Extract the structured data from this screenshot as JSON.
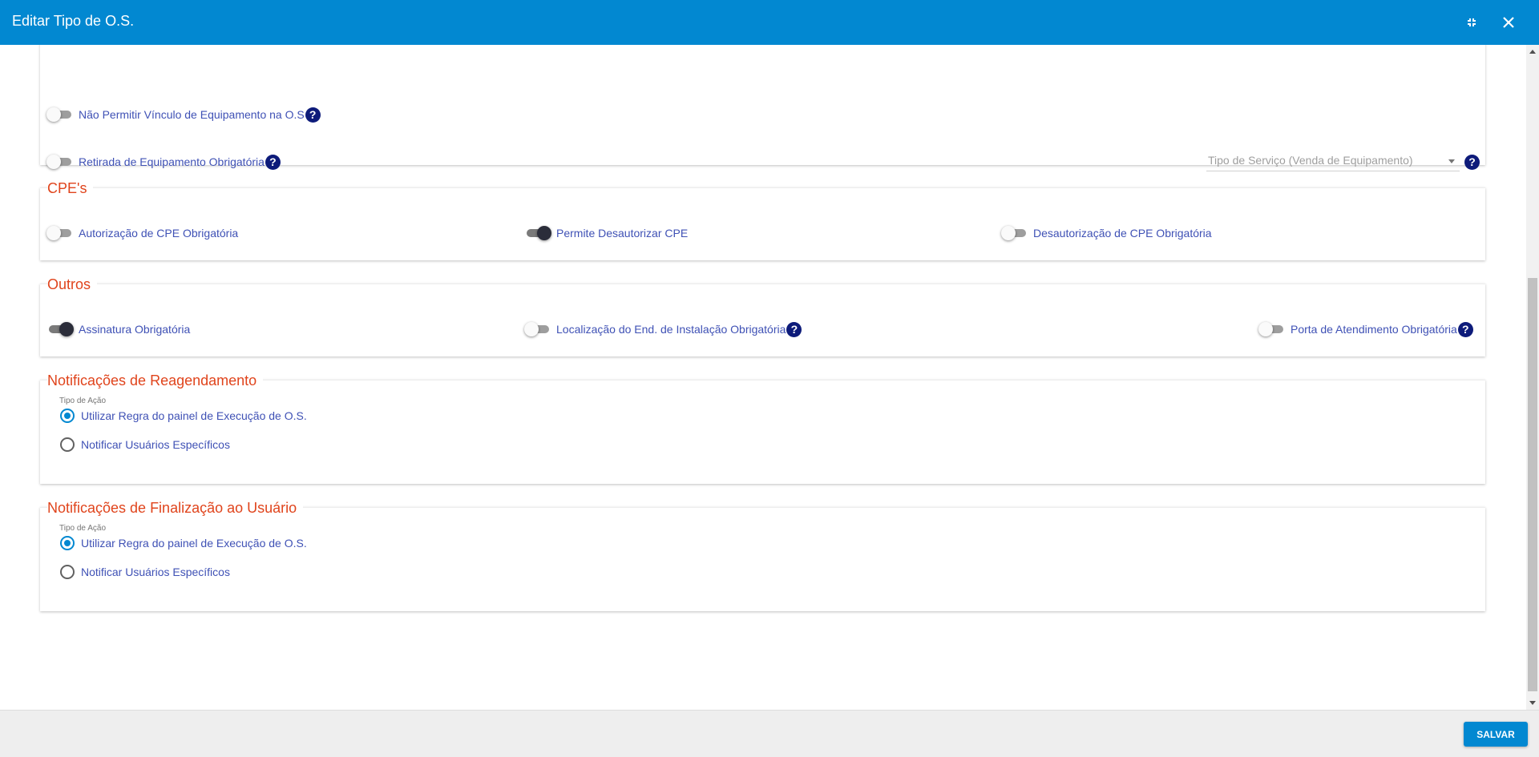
{
  "window": {
    "title": "Editar Tipo de O.S.",
    "minimize_icon": "collapse-icon",
    "close_icon": "close-icon"
  },
  "equipment": {
    "no_link_label": "Não Permitir Vínculo de Equipamento na O.S",
    "no_link_on": false,
    "removal_label": "Retirada de Equipamento Obrigatória",
    "removal_on": false,
    "service_type_placeholder": "Tipo de Serviço (Venda de Equipamento)"
  },
  "cpes": {
    "legend": "CPE's",
    "auth_label": "Autorização de CPE Obrigatória",
    "auth_on": false,
    "allow_deauth_label": "Permite Desautorizar CPE",
    "allow_deauth_on": true,
    "deauth_label": "Desautorização de CPE Obrigatória",
    "deauth_on": false
  },
  "outros": {
    "legend": "Outros",
    "signature_label": "Assinatura Obrigatória",
    "signature_on": true,
    "location_label": "Localização do End. de Instalação Obrigatória",
    "location_on": false,
    "port_label": "Porta de Atendimento Obrigatória",
    "port_on": false
  },
  "reschedule": {
    "legend": "Notificações de Reagendamento",
    "group_label": "Tipo de Ação",
    "options": [
      "Utilizar Regra do painel de Execução de O.S.",
      "Notificar Usuários Específicos"
    ],
    "selected": 0
  },
  "finalization": {
    "legend": "Notificações de Finalização ao Usuário",
    "group_label": "Tipo de Ação",
    "options": [
      "Utilizar Regra do painel de Execução de O.S.",
      "Notificar Usuários Específicos"
    ],
    "selected": 0
  },
  "help_glyph": "?",
  "footer": {
    "save_label": "SALVAR"
  },
  "colors": {
    "header_bg": "#0288d1",
    "legend": "#e0441c",
    "label": "#3f51b5",
    "help_icon": "#0d1b7a"
  }
}
